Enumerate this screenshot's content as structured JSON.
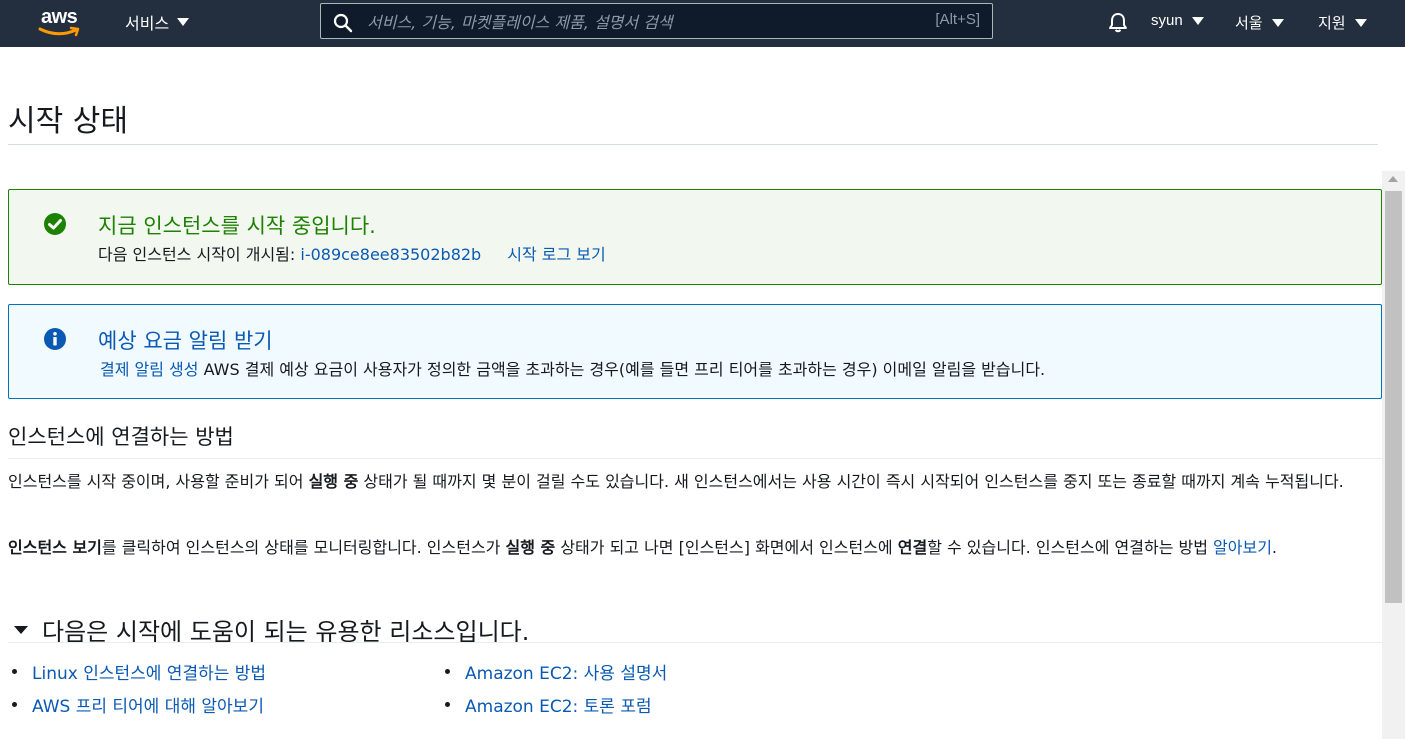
{
  "nav": {
    "logo_text": "aws",
    "services_label": "서비스",
    "search_placeholder": "서비스, 기능, 마켓플레이스 제품, 설명서 검색",
    "search_shortcut": "[Alt+S]",
    "user_label": "syun",
    "region_label": "서울",
    "support_label": "지원"
  },
  "page": {
    "title": "시작 상태"
  },
  "success_alert": {
    "heading": "지금 인스턴스를 시작 중입니다.",
    "body_prefix": "다음 인스턴스 시작이 개시됨: ",
    "instance_id": "i-089ce8ee83502b82b",
    "log_link": "시작 로그 보기"
  },
  "info_alert": {
    "heading": "예상 요금 알림 받기",
    "link": "결제 알림 생성",
    "body": " AWS 결제 예상 요금이 사용자가 정의한 금액을 초과하는 경우(예를 들면 프리 티어를 초과하는 경우) 이메일 알림을 받습니다."
  },
  "connect_section": {
    "title": "인스턴스에 연결하는 방법",
    "p1_a": "인스턴스를 시작 중이며, 사용할 준비가 되어 ",
    "p1_bold": "실행 중",
    "p1_b": " 상태가 될 때까지 몇 분이 걸릴 수도 있습니다. 새 인스턴스에서는 사용 시간이 즉시 시작되어 인스턴스를 중지 또는 종료할 때까지 계속 누적됩니다.",
    "p2_bold1": "인스턴스 보기",
    "p2_a": "를 클릭하여 인스턴스의 상태를 모니터링합니다. 인스턴스가 ",
    "p2_bold2": "실행 중",
    "p2_b": " 상태가 되고 나면 [인스턴스] 화면에서 인스턴스에 ",
    "p2_bold3": "연결",
    "p2_c": "할 수 있습니다. 인스턴스에 연결하는 방법 ",
    "p2_link": "알아보기",
    "p2_end": "."
  },
  "resources": {
    "title": "다음은 시작에 도움이 되는 유용한 리소스입니다.",
    "left": [
      "Linux 인스턴스에 연결하는 방법",
      "AWS 프리 티어에 대해 알아보기"
    ],
    "right": [
      "Amazon EC2: 사용 설명서",
      "Amazon EC2: 토론 포럼"
    ]
  },
  "colors": {
    "nav_bg": "#232f3e",
    "aws_orange": "#ff9900",
    "success": "#1d8102",
    "info": "#0073bb",
    "link": "#0a59b3"
  },
  "icons": [
    "search-icon",
    "bell-icon",
    "check-circle-icon",
    "info-circle-icon",
    "caret-down-icon"
  ]
}
